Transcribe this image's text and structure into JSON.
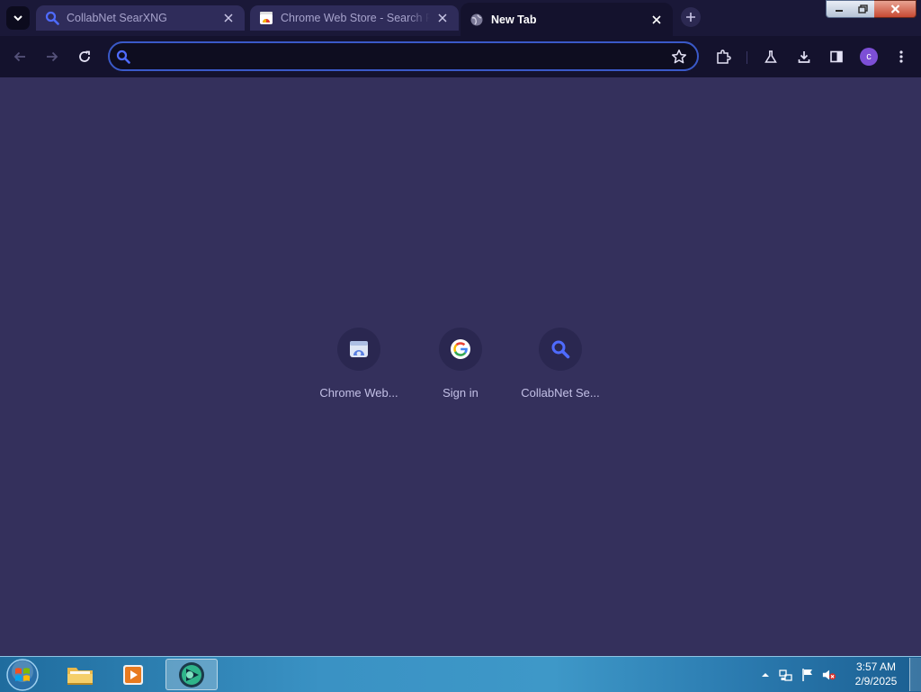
{
  "tabs": [
    {
      "title": "CollabNet SearXNG",
      "favicon": "search-icon",
      "active": false
    },
    {
      "title": "Chrome Web Store - Search Results",
      "favicon": "chrome-web-store-icon",
      "active": false
    },
    {
      "title": "New Tab",
      "favicon": "globe-icon",
      "active": true
    }
  ],
  "omnibox": {
    "value": "",
    "placeholder": ""
  },
  "profile": {
    "initial": "c",
    "color": "#7d4fd6"
  },
  "shortcuts": [
    {
      "label": "Chrome Web...",
      "icon": "chrome-web-store-icon"
    },
    {
      "label": "Sign in",
      "icon": "google-icon"
    },
    {
      "label": "CollabNet Se...",
      "icon": "search-icon"
    }
  ],
  "taskbar": {
    "apps": [
      "file-explorer-icon",
      "media-player-icon",
      "browser-icon"
    ],
    "tray": [
      "show-hidden-icons-arrow",
      "network-icon",
      "action-center-flag-icon",
      "volume-muted-icon"
    ],
    "time": "3:57 AM",
    "date": "2/9/2025"
  },
  "colors": {
    "accent": "#3a59c8",
    "page_bg": "#34305c",
    "toolbar_bg": "#14122d"
  }
}
